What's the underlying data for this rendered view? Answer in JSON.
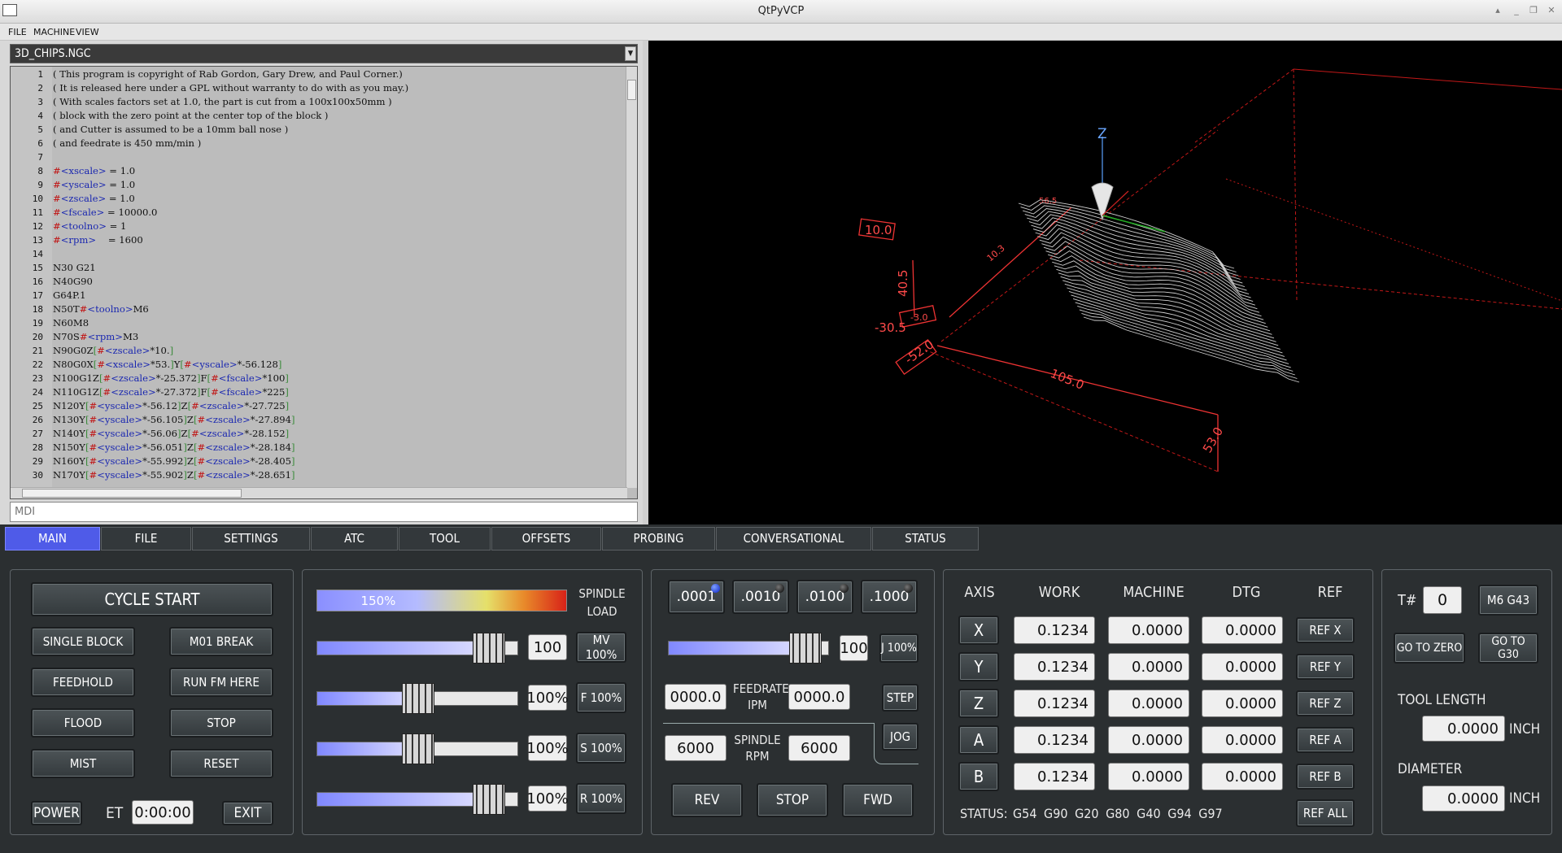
{
  "window": {
    "title": "QtPyVCP"
  },
  "menu": [
    "FILE",
    "MACHINE",
    "VIEW"
  ],
  "editor": {
    "filename": "3D_CHIPS.NGC",
    "lines": [
      {
        "n": "1",
        "t": "( This program is copyright of Rab Gordon, Gary Drew, and Paul Corner.)"
      },
      {
        "n": "2",
        "t": "( It is released here under a GPL without warranty to do with as you may.)"
      },
      {
        "n": "3",
        "t": "( With scales factors set at 1.0, the part is cut from a 100x100x50mm )"
      },
      {
        "n": "4",
        "t": "( block with the zero point at the center top of the block )"
      },
      {
        "n": "5",
        "t": "( and Cutter is assumed to be a 10mm ball nose )"
      },
      {
        "n": "6",
        "t": "( and feedrate is 450 mm/min )"
      },
      {
        "n": "7",
        "t": ""
      },
      {
        "n": "8",
        "t": "#<xscale> = 1.0"
      },
      {
        "n": "9",
        "t": "#<yscale> = 1.0"
      },
      {
        "n": "10",
        "t": "#<zscale> = 1.0"
      },
      {
        "n": "11",
        "t": "#<fscale> = 10000.0"
      },
      {
        "n": "12",
        "t": "#<toolno> = 1"
      },
      {
        "n": "13",
        "t": "#<rpm>    = 1600"
      },
      {
        "n": "14",
        "t": ""
      },
      {
        "n": "15",
        "t": "N30 G21"
      },
      {
        "n": "16",
        "t": "N40G90"
      },
      {
        "n": "17",
        "t": "G64P.1"
      },
      {
        "n": "18",
        "t": "N50T#<toolno>M6"
      },
      {
        "n": "19",
        "t": "N60M8"
      },
      {
        "n": "20",
        "t": "N70S#<rpm>M3"
      },
      {
        "n": "21",
        "t": "N90G0Z[#<zscale>*10.]"
      },
      {
        "n": "22",
        "t": "N80G0X[#<xscale>*53.]Y[#<yscale>*-56.128]"
      },
      {
        "n": "23",
        "t": "N100G1Z[#<zscale>*-25.372]F[#<fscale>*100]"
      },
      {
        "n": "24",
        "t": "N110G1Z[#<zscale>*-27.372]F[#<fscale>*225]"
      },
      {
        "n": "25",
        "t": "N120Y[#<yscale>*-56.12]Z[#<zscale>*-27.725]"
      },
      {
        "n": "26",
        "t": "N130Y[#<yscale>*-56.105]Z[#<zscale>*-27.894]"
      },
      {
        "n": "27",
        "t": "N140Y[#<yscale>*-56.06]Z[#<zscale>*-28.152]"
      },
      {
        "n": "28",
        "t": "N150Y[#<yscale>*-56.051]Z[#<zscale>*-28.184]"
      },
      {
        "n": "29",
        "t": "N160Y[#<yscale>*-55.992]Z[#<zscale>*-28.405]"
      },
      {
        "n": "30",
        "t": "N170Y[#<yscale>*-55.902]Z[#<zscale>*-28.651]"
      }
    ]
  },
  "mdi": {
    "placeholder": "MDI"
  },
  "viewport": {
    "labels": {
      "z_axis": "Z",
      "dim_10": "10.0",
      "dim_40": "40.5",
      "dim_305": "-30.5",
      "dim_52": "-52.0",
      "dim_1050": "105.0",
      "dim_530": "53.0",
      "dim_small1": "10.3",
      "dim_small2": "56.5",
      "dim_small3": "-3.0"
    }
  },
  "tabs": [
    "MAIN",
    "FILE",
    "SETTINGS",
    "ATC",
    "TOOL",
    "OFFSETS",
    "PROBING",
    "CONVERSATIONAL",
    "STATUS"
  ],
  "program": {
    "cycle_start": "CYCLE START",
    "single_block": "SINGLE BLOCK",
    "m01_break": "M01 BREAK",
    "feedhold": "FEEDHOLD",
    "run_from_here": "RUN FM HERE",
    "flood": "FLOOD",
    "stop": "STOP",
    "mist": "MIST",
    "reset": "RESET",
    "power": "POWER",
    "et_label": "ET",
    "et_value": "0:00:00",
    "exit": "EXIT"
  },
  "overrides": {
    "spindle_load_label": "SPINDLE LOAD",
    "spindle_load_value": "150%",
    "rows": [
      {
        "value": "100",
        "button": "MV 100%",
        "fraction": 0.85
      },
      {
        "value": "100%",
        "button": "F 100%",
        "fraction": 0.5
      },
      {
        "value": "100%",
        "button": "S 100%",
        "fraction": 0.5
      },
      {
        "value": "100%",
        "button": "R 100%",
        "fraction": 0.85
      }
    ]
  },
  "jog": {
    "increments": [
      ".0001",
      ".0010",
      ".0100",
      ".1000"
    ],
    "active_increment": 0,
    "jog_value": "100",
    "jog_button": "J 100%",
    "jog_fraction": 0.85,
    "feedrate_label": "FEEDRATE IPM",
    "feed_left": "0000.0",
    "feed_right": "0000.0",
    "step": "STEP",
    "jog_mode": "JOG",
    "spindle_label": "SPINDLE RPM",
    "rpm_left": "6000",
    "rpm_right": "6000",
    "rev": "REV",
    "stop": "STOP",
    "fwd": "FWD"
  },
  "dro": {
    "headers": [
      "AXIS",
      "WORK",
      "MACHINE",
      "DTG",
      "REF"
    ],
    "axes": [
      {
        "axis": "X",
        "work": "0.1234",
        "machine": "0.0000",
        "dtg": "0.0000",
        "ref": "REF X"
      },
      {
        "axis": "Y",
        "work": "0.1234",
        "machine": "0.0000",
        "dtg": "0.0000",
        "ref": "REF Y"
      },
      {
        "axis": "Z",
        "work": "0.1234",
        "machine": "0.0000",
        "dtg": "0.0000",
        "ref": "REF Z"
      },
      {
        "axis": "A",
        "work": "0.1234",
        "machine": "0.0000",
        "dtg": "0.0000",
        "ref": "REF A"
      },
      {
        "axis": "B",
        "work": "0.1234",
        "machine": "0.0000",
        "dtg": "0.0000",
        "ref": "REF B"
      }
    ],
    "status_label": "STATUS:",
    "status_codes": "G54 G90 G20 G80 G40 G94 G97",
    "ref_all": "REF ALL"
  },
  "tool": {
    "t_label": "T#",
    "t_value": "0",
    "m6": "M6 G43",
    "go_zero": "GO TO ZERO",
    "go_g30": "GO TO G30",
    "length_label": "TOOL LENGTH",
    "length_value": "0.0000",
    "length_unit": "INCH",
    "diameter_label": "DIAMETER",
    "diameter_value": "0.0000",
    "diameter_unit": "INCH"
  },
  "colors": {
    "accent": "#4f5be8",
    "toolpath": "#e33",
    "grid": "#ff3030"
  }
}
